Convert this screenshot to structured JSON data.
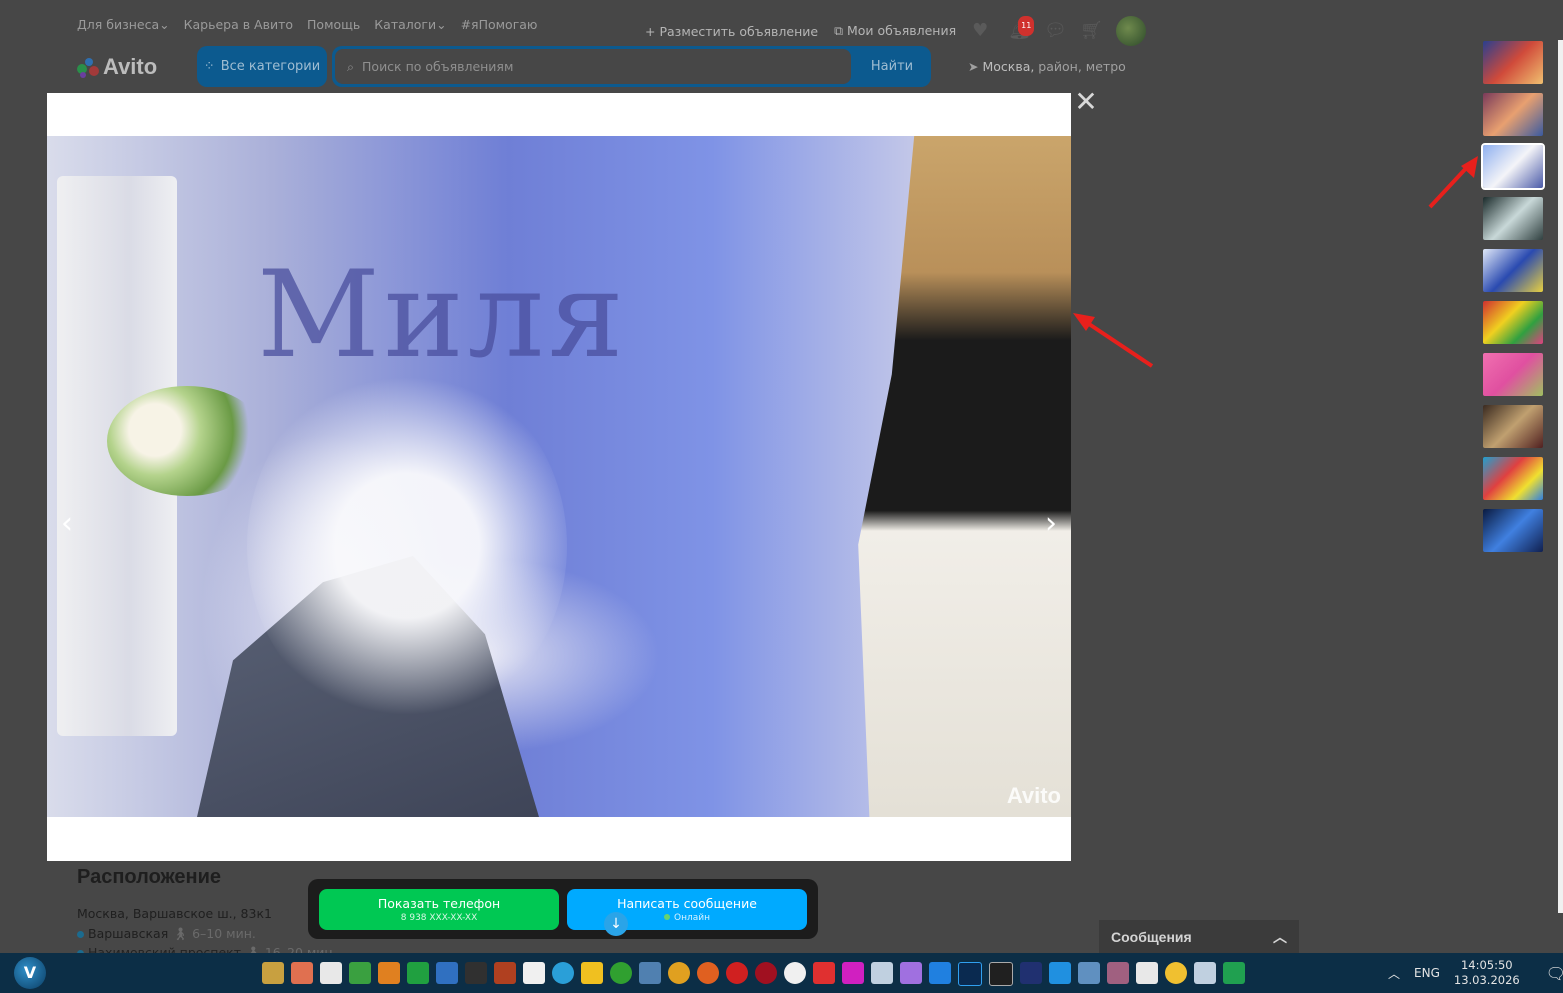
{
  "header": {
    "nav": [
      "Для бизнеса",
      "Карьера в Авито",
      "Помощь",
      "Каталоги",
      "#яПомогаю"
    ],
    "post_ad": "Разместить объявление",
    "my_ads": "Мои объявления",
    "notifications_count": "11",
    "logo": "Avito",
    "all_categories": "Все категории",
    "search_placeholder": "Поиск по объявлениям",
    "search_button": "Найти",
    "location_city": "Москва,",
    "location_rest": " район, метро"
  },
  "viewer": {
    "watermark": "Avito",
    "prev": "‹",
    "next": "›",
    "close": "✕",
    "photo_sign": "Миля",
    "thumbnail_count": 10,
    "active_thumbnail": 3
  },
  "location": {
    "title": "Расположение",
    "address": "Москва, Варшавское ш., 83к1",
    "metro1_name": "Варшавская",
    "metro1_time": "6–10 мин.",
    "metro2_name": "Нахимовский проспект",
    "metro2_time": "16–20 мин."
  },
  "actions": {
    "phone_label": "Показать телефон",
    "phone_number": "8 938 XXX-XX-XX",
    "message_label": "Написать сообщение",
    "message_status": "Онлайн"
  },
  "messages_panel": {
    "title": "Сообщения"
  },
  "taskbar": {
    "lang": "ENG",
    "time": "14:05:50",
    "date": "13.03.2026"
  }
}
